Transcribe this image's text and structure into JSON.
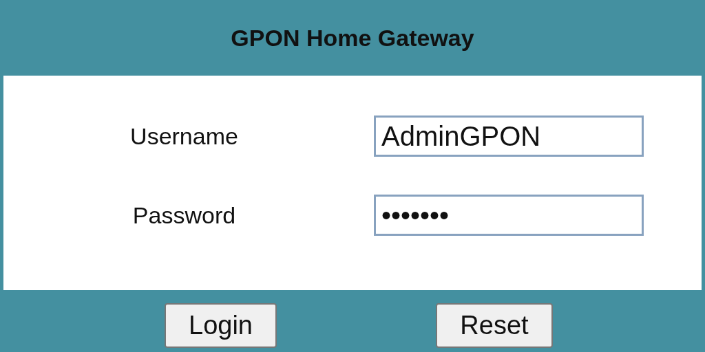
{
  "header": {
    "title": "GPON Home Gateway"
  },
  "fields": [
    {
      "label": "Username",
      "value": "AdminGPON"
    },
    {
      "label": "Password",
      "value": "•••••••"
    }
  ],
  "buttons": [
    "Login",
    "Reset"
  ]
}
